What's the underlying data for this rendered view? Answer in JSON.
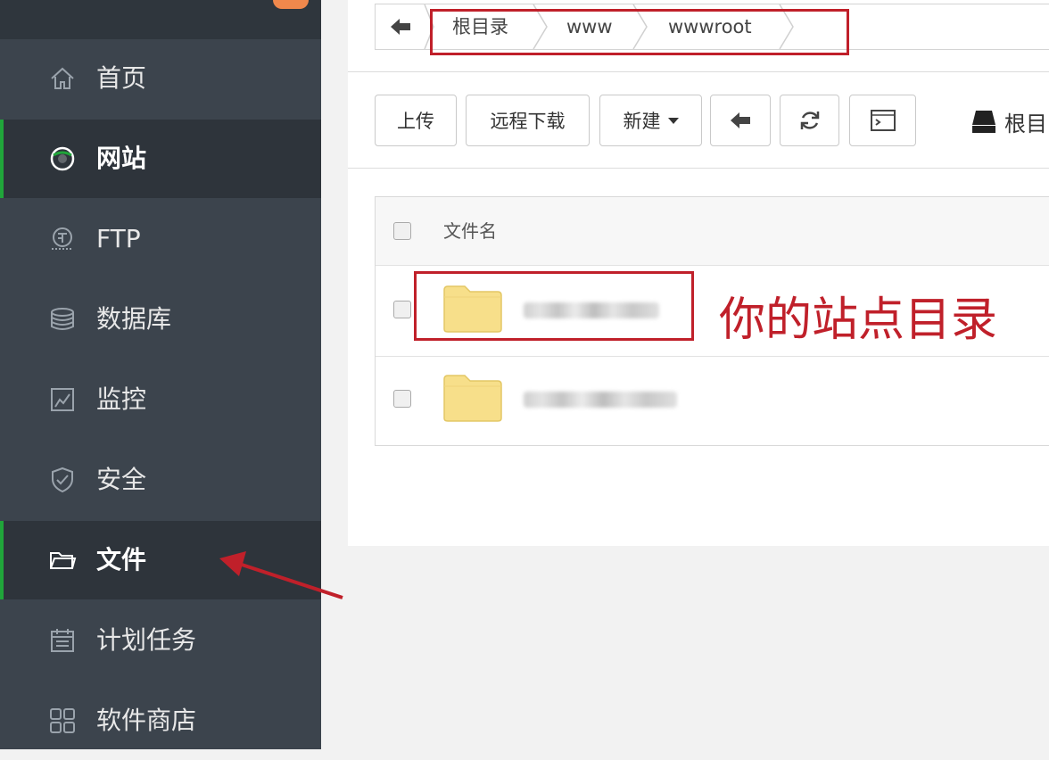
{
  "sidebar": {
    "items": [
      {
        "id": "home",
        "label": "首页",
        "icon": "home-icon"
      },
      {
        "id": "website",
        "label": "网站",
        "icon": "globe-icon"
      },
      {
        "id": "ftp",
        "label": "FTP",
        "icon": "ftp-icon"
      },
      {
        "id": "database",
        "label": "数据库",
        "icon": "database-icon"
      },
      {
        "id": "monitor",
        "label": "监控",
        "icon": "monitor-chart-icon"
      },
      {
        "id": "security",
        "label": "安全",
        "icon": "shield-icon"
      },
      {
        "id": "files",
        "label": "文件",
        "icon": "folder-icon"
      },
      {
        "id": "cron",
        "label": "计划任务",
        "icon": "calendar-icon"
      },
      {
        "id": "store",
        "label": "软件商店",
        "icon": "grid-icon"
      }
    ],
    "active": "文件"
  },
  "breadcrumb": {
    "crumbs": [
      "根目录",
      "www",
      "wwwroot"
    ]
  },
  "toolbar": {
    "upload": "上传",
    "remote_download": "远程下载",
    "new": "新建",
    "root_label": "根目"
  },
  "table": {
    "header_name": "文件名",
    "rows": [
      {
        "type": "folder",
        "name": ""
      },
      {
        "type": "folder",
        "name": ""
      }
    ]
  },
  "annotation": {
    "text": "你的站点目录"
  },
  "colors": {
    "sidebar_bg": "#3c444d",
    "active_indicator": "#20a53a",
    "annotation_red": "#c0202a",
    "folder_yellow": "#f7df8a"
  }
}
